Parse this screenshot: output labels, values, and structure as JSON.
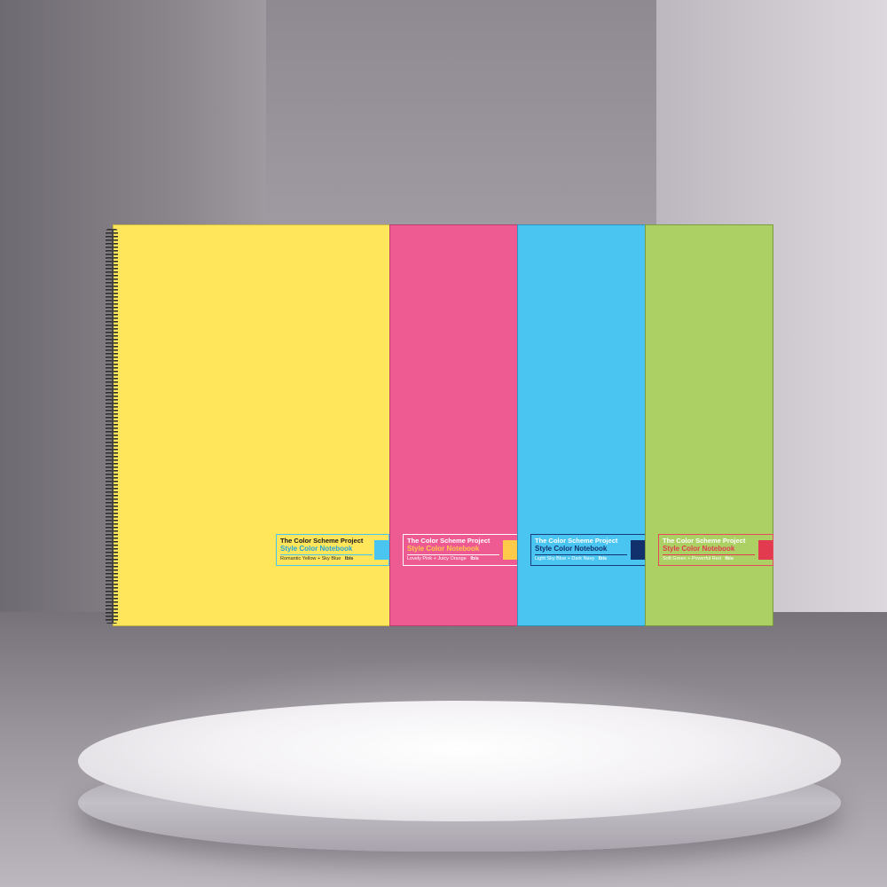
{
  "scene": {
    "wall_colors": [
      "#8b868c",
      "#a9a4ab",
      "#cfcad0"
    ],
    "podium_color": "#f3f1f4"
  },
  "notebooks": [
    {
      "project": "The Color Scheme Project",
      "title": "Style Color Notebook",
      "colors": "Romantic Yellow + Sky Blue",
      "brand": "Ibis",
      "cover_color": "#ffe65a",
      "accent_color": "#4ac5f1"
    },
    {
      "project": "The Color Scheme Project",
      "title": "Style Color Notebook",
      "colors": "Lovely Pink + Juicy Orange",
      "brand": "Ibis",
      "cover_color": "#ee5b93",
      "accent_color": "#ffc94a"
    },
    {
      "project": "The Color Scheme Project",
      "title": "Style Color Notebook",
      "colors": "Light Sky Blue + Dark Navy",
      "brand": "Ibis",
      "cover_color": "#4ac5f1",
      "accent_color": "#12306c"
    },
    {
      "project": "The Color Scheme Project",
      "title": "Style Color Notebook",
      "colors": "Soft Green + Powerful Red",
      "brand": "Ibis",
      "cover_color": "#acd063",
      "accent_color": "#e23b4f"
    }
  ]
}
